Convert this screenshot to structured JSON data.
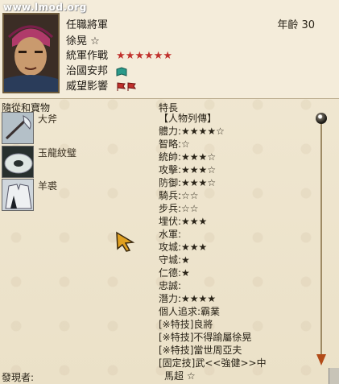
{
  "watermark": "www.lmod.org",
  "header": {
    "title": "任職將軍",
    "age": "年齡 30",
    "name": "徐晃 ☆",
    "rows": [
      {
        "label": "統軍作戰",
        "value": "★★★★★★"
      },
      {
        "label": "治國安邦",
        "value": ""
      },
      {
        "label": "威望影響",
        "value": ""
      }
    ]
  },
  "items_section": {
    "title": "隨從和寶物",
    "items": [
      {
        "name": "大斧",
        "icon": "axe-icon"
      },
      {
        "name": "玉龍紋璧",
        "icon": "jade-disc-icon"
      },
      {
        "name": "羊裘",
        "icon": "sheepskin-coat-icon"
      }
    ]
  },
  "traits_section": {
    "title": "特長",
    "lines": [
      "【人物列傳】",
      "體力:★★★★☆",
      "智略:☆",
      "統帥:★★★☆",
      "攻擊:★★★☆",
      "防御:★★★☆",
      "騎兵:☆☆",
      "步兵:☆☆",
      "埋伏:★★★",
      "水軍:",
      "攻城:★★★",
      "守城:★",
      "仁德:★",
      "忠誠:",
      "潛力:★★★★",
      "個人追求:霸業",
      "[※特技]良將",
      "[※特技]不得踰屬徐晃",
      "[※特技]當世周亞夫",
      "[固定技]武<<強健>>中"
    ]
  },
  "footer": {
    "label": "發現者:",
    "value": "馬超 ☆"
  },
  "colors": {
    "background": "#efe6cf",
    "star_red": "#c0302c",
    "scroll_arrow": "#b24b18"
  }
}
